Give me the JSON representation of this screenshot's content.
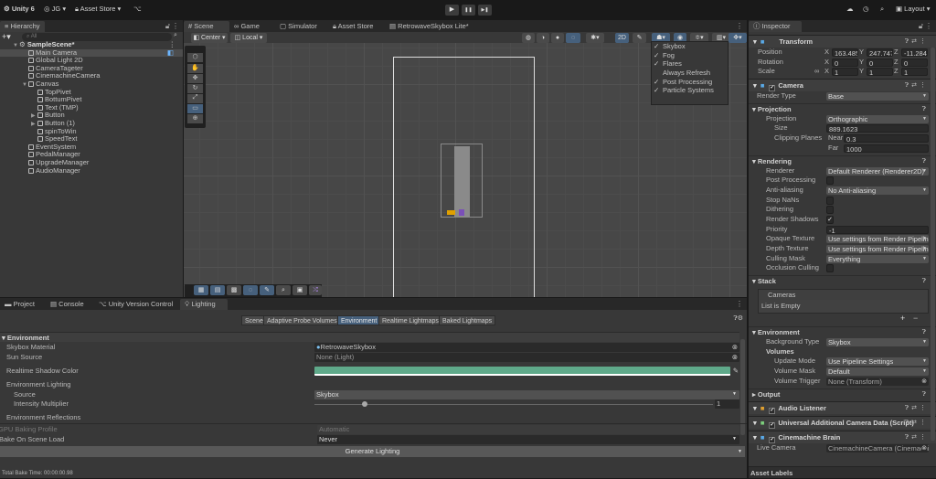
{
  "topbar": {
    "app_label": "Unity 6",
    "account": "JG",
    "asset_store": "Asset Store",
    "layout": "Layout",
    "play": "▶",
    "pause": "❚❚",
    "step": "▶❚"
  },
  "hierarchy": {
    "tab": "Hierarchy",
    "search_placeholder": "All",
    "items": [
      {
        "label": "SampleScene*",
        "depth": 0,
        "arrow": "▼",
        "scene": true
      },
      {
        "label": "Main Camera",
        "depth": 1,
        "selected": true
      },
      {
        "label": "Global Light 2D",
        "depth": 1
      },
      {
        "label": "CameraTageter",
        "depth": 1
      },
      {
        "label": "CinemachineCamera",
        "depth": 1
      },
      {
        "label": "Canvas",
        "depth": 1,
        "arrow": "▼"
      },
      {
        "label": "TopPivet",
        "depth": 2
      },
      {
        "label": "BottumPivet",
        "depth": 2
      },
      {
        "label": "Text (TMP)",
        "depth": 2
      },
      {
        "label": "Button",
        "depth": 2,
        "arrow": "▶"
      },
      {
        "label": "Button (1)",
        "depth": 2,
        "arrow": "▶"
      },
      {
        "label": "spinToWin",
        "depth": 2
      },
      {
        "label": "SpeedText",
        "depth": 2
      },
      {
        "label": "EventSystem",
        "depth": 1
      },
      {
        "label": "PedalManager",
        "depth": 1
      },
      {
        "label": "UpgradeManager",
        "depth": 1
      },
      {
        "label": "AudioManager",
        "depth": 1
      }
    ]
  },
  "scene": {
    "tabs": [
      "Scene",
      "Game",
      "Simulator",
      "Asset Store",
      "RetrowaveSkybox Lite*"
    ],
    "pivot": "Center",
    "space": "Local",
    "mode_2d": "2D",
    "effects_menu": [
      {
        "label": "Skybox",
        "checked": true
      },
      {
        "label": "Fog",
        "checked": true
      },
      {
        "label": "Flares",
        "checked": true
      },
      {
        "label": "Always Refresh",
        "checked": false
      },
      {
        "label": "Post Processing",
        "checked": true
      },
      {
        "label": "Particle Systems",
        "checked": true
      }
    ]
  },
  "bottom": {
    "tabs": [
      "Project",
      "Console",
      "Unity Version Control",
      "Lighting"
    ],
    "lighting_tabs": [
      "Scene",
      "Adaptive Probe Volumes",
      "Environment",
      "Realtime Lightmaps",
      "Baked Lightmaps"
    ],
    "active_lighting_tab": "Environment",
    "section": "Environment",
    "skybox_material_label": "Skybox Material",
    "skybox_material_value": "RetrowaveSkybox",
    "sun_source_label": "Sun Source",
    "sun_source_value": "None (Light)",
    "shadow_color_label": "Realtime Shadow Color",
    "shadow_color": "#5fa98a",
    "env_lighting_label": "Environment Lighting",
    "source_label": "Source",
    "source_value": "Skybox",
    "intensity_label": "Intensity Multiplier",
    "intensity_value": "1",
    "intensity_fraction": 0.125,
    "env_reflections_label": "Environment Reflections",
    "gpu_profile_label": "GPU Baking Profile",
    "gpu_profile_value": "Automatic",
    "bake_on_load_label": "Bake On Scene Load",
    "bake_on_load_value": "Never",
    "generate_label": "Generate Lighting",
    "bake_time": "Total Bake Time: 00:00:00.98"
  },
  "inspector": {
    "tab": "Inspector",
    "rows": [
      {
        "type": "component",
        "label": "Transform",
        "icon": "transform-icon"
      },
      {
        "type": "vec3",
        "label": "Position",
        "x": "163.485",
        "y": "247.747",
        "z": "-11.2841"
      },
      {
        "type": "vec3",
        "label": "Rotation",
        "x": "0",
        "y": "0",
        "z": "0"
      },
      {
        "type": "vec3",
        "label": "Scale",
        "x": "1",
        "y": "1",
        "z": "1"
      },
      {
        "type": "component",
        "label": "Camera",
        "icon": "camera-icon",
        "checkbox": true
      },
      {
        "type": "field",
        "label": "Render Type",
        "control": "dd",
        "value": "Base",
        "indent": 1
      },
      {
        "type": "section",
        "label": "Projection"
      },
      {
        "type": "field",
        "label": "Projection",
        "control": "dd",
        "value": "Orthographic",
        "indent": 2
      },
      {
        "type": "field",
        "label": "Size",
        "control": "txt",
        "value": "889.1623",
        "indent": 3
      },
      {
        "type": "field",
        "label": "Clipping Planes",
        "control": "sub",
        "sub": "Near",
        "value": "0.3",
        "indent": 3
      },
      {
        "type": "field",
        "label": "",
        "control": "sub",
        "sub": "Far",
        "value": "1000",
        "indent": 3
      },
      {
        "type": "section",
        "label": "Rendering"
      },
      {
        "type": "field",
        "label": "Renderer",
        "control": "dd",
        "value": "Default Renderer (Renderer2D)",
        "indent": 2
      },
      {
        "type": "field",
        "label": "Post Processing",
        "control": "chk",
        "checked": false,
        "indent": 2
      },
      {
        "type": "field",
        "label": "Anti-aliasing",
        "control": "dd",
        "value": "No Anti-aliasing",
        "indent": 2
      },
      {
        "type": "field",
        "label": "Stop NaNs",
        "control": "chk",
        "checked": false,
        "indent": 2
      },
      {
        "type": "field",
        "label": "Dithering",
        "control": "chk",
        "checked": false,
        "indent": 2
      },
      {
        "type": "field",
        "label": "Render Shadows",
        "control": "chk",
        "checked": true,
        "indent": 2
      },
      {
        "type": "field",
        "label": "Priority",
        "control": "txt",
        "value": "-1",
        "indent": 2
      },
      {
        "type": "field",
        "label": "Opaque Texture",
        "control": "dd",
        "value": "Use settings from Render Pipeline",
        "indent": 2
      },
      {
        "type": "field",
        "label": "Depth Texture",
        "control": "dd",
        "value": "Use settings from Render Pipeline",
        "indent": 2
      },
      {
        "type": "field",
        "label": "Culling Mask",
        "control": "dd",
        "value": "Everything",
        "indent": 2
      },
      {
        "type": "field",
        "label": "Occlusion Culling",
        "control": "chk",
        "checked": false,
        "indent": 2
      },
      {
        "type": "section",
        "label": "Stack"
      },
      {
        "type": "list",
        "header": "Cameras",
        "empty": "List is Empty",
        "add": "+",
        "remove": "−"
      },
      {
        "type": "section",
        "label": "Environment"
      },
      {
        "type": "field",
        "label": "Background Type",
        "control": "dd",
        "value": "Skybox",
        "indent": 2
      },
      {
        "type": "field",
        "label": "Volumes",
        "control": "none",
        "bold": true,
        "indent": 2
      },
      {
        "type": "field",
        "label": "Update Mode",
        "control": "dd",
        "value": "Use Pipeline Settings",
        "indent": 3
      },
      {
        "type": "field",
        "label": "Volume Mask",
        "control": "dd",
        "value": "Default",
        "indent": 3
      },
      {
        "type": "field",
        "label": "Volume Trigger",
        "control": "obj",
        "value": "None (Transform)",
        "indent": 3
      },
      {
        "type": "section",
        "label": "Output",
        "collapsed": true
      },
      {
        "type": "component",
        "label": "Audio Listener",
        "icon": "headphones-icon",
        "checkbox": true
      },
      {
        "type": "component",
        "label": "Universal Additional Camera Data (Script)",
        "icon": "script-icon",
        "checkbox": true
      },
      {
        "type": "component",
        "label": "Cinemachine Brain",
        "icon": "cinemachine-icon",
        "checkbox": true
      },
      {
        "type": "field",
        "label": "Live Camera",
        "control": "obj",
        "value": "CinemachineCamera (Cinemachine",
        "indent": 1
      }
    ],
    "footer": "Asset Labels"
  }
}
